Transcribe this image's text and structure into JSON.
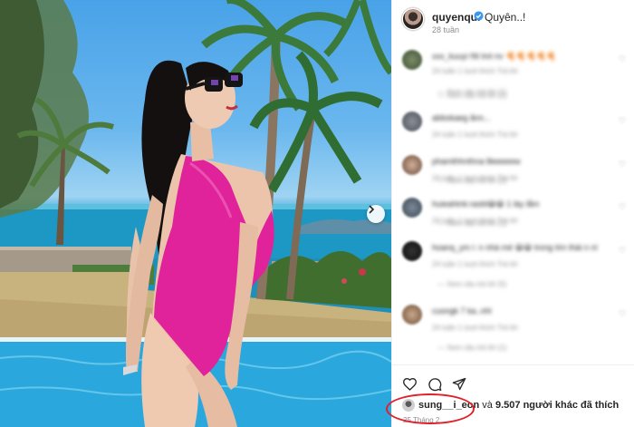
{
  "post": {
    "username": "quyenqui",
    "caption": "Quyên..!",
    "time_ago": "28 tuần",
    "like_user": "sung__i_eon",
    "likes_joiner": " và ",
    "likes_count": "9.507",
    "likes_suffix": " người khác đã thích",
    "date": "25 Tháng 2"
  },
  "comments": [
    {
      "text": "xxx_kuuyi ñtt lmt nv 🍕🍕🍕🍕🍕",
      "meta": "24 tuần   1 lượt thích   Trả lời",
      "replies": "— Xem câu trả lời (1)"
    },
    {
      "text": "abbokaeg ãnn...",
      "meta": "24 tuần   1 lượt thích   Trả lời",
      "replies": ""
    },
    {
      "text": "phamthhnthna llleeeeew",
      "meta": "24 tuần   1 lượt thích   Trả lời",
      "replies": "— Xem câu trả lời (2)"
    },
    {
      "text": "huieahtnk:rasbl😀😀 1 lày lắm",
      "meta": "24 tuần   1 lượt thích   Trả lời",
      "replies": "— Xem câu trả lời (1)"
    },
    {
      "text": "hoanq_ym i: n nhá mé 😀😀 trong tím thái n ní",
      "meta": "24 tuần   1 lượt thích   Trả lời",
      "replies": "— Xem câu trả lời (5)"
    },
    {
      "text": "cuongk 7 ka..nhl",
      "meta": "24 tuần   1 lượt thích   Trả lời",
      "replies": "— Xem câu trả lời (1)"
    }
  ],
  "colors": {
    "swimsuit": "#e0239a",
    "highlight_circle": "#e0202a",
    "verified_badge": "#3897f0"
  },
  "icons": [
    "next-arrow-icon",
    "verified-icon",
    "heart-icon",
    "comment-icon",
    "share-icon"
  ]
}
